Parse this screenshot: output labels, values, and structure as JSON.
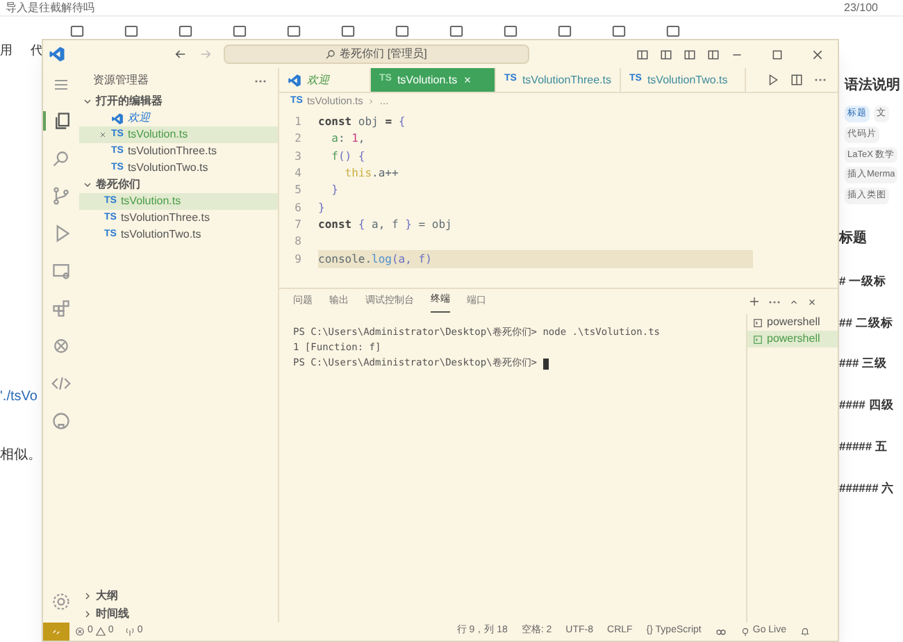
{
  "browser": {
    "top_text": "导入是往截解待吗",
    "counter": "23/100",
    "toolbar_labels": [
      "用",
      "代"
    ],
    "left_fragments": [
      "'./tsVo",
      "相似。"
    ],
    "right_panel": {
      "title": "语法说明",
      "tags": [
        {
          "label": "标题",
          "selected": true
        },
        {
          "label": "文",
          "selected": false
        },
        {
          "label": "代码片",
          "selected": false
        },
        {
          "label": "LaTeX 数学",
          "selected": false
        },
        {
          "label": "插入Merma",
          "selected": false
        },
        {
          "label": "插入类图",
          "selected": false
        }
      ],
      "section": "标题",
      "headings": [
        "# 一级标",
        "## 二级标",
        "### 三级",
        "#### 四级",
        "##### 五",
        "###### 六"
      ]
    }
  },
  "window": {
    "title": "卷死你们 [管理员]",
    "sidebar": {
      "title": "资源管理器",
      "open_editors": {
        "label": "打开的编辑器",
        "expanded": true,
        "items": [
          {
            "label": "欢迎",
            "kind": "welcome",
            "selected": false
          },
          {
            "label": "tsVolution.ts",
            "kind": "ts",
            "icon": "TS",
            "selected": true
          },
          {
            "label": "tsVolutionThree.ts",
            "kind": "ts",
            "icon": "TS",
            "selected": false
          },
          {
            "label": "tsVolutionTwo.ts",
            "kind": "ts",
            "icon": "TS",
            "selected": false
          }
        ]
      },
      "folder": {
        "label": "卷死你们",
        "expanded": true,
        "items": [
          {
            "label": "tsVolution.ts",
            "icon": "TS",
            "selected": true
          },
          {
            "label": "tsVolutionThree.ts",
            "icon": "TS",
            "selected": false
          },
          {
            "label": "tsVolutionTwo.ts",
            "icon": "TS",
            "selected": false
          }
        ]
      },
      "bottom_sections": [
        "大纲",
        "时间线"
      ]
    },
    "tabs": [
      {
        "label": "欢迎",
        "kind": "welcome",
        "selected": false
      },
      {
        "label": "tsVolution.ts",
        "kind": "ts",
        "icon": "TS",
        "selected": true
      },
      {
        "label": "tsVolutionThree.ts",
        "kind": "ts",
        "icon": "TS",
        "selected": false
      },
      {
        "label": "tsVolutionTwo.ts",
        "kind": "ts",
        "icon": "TS",
        "selected": false
      }
    ],
    "breadcrumb": {
      "icon": "TS",
      "parts": [
        "tsVolution.ts",
        "..."
      ]
    },
    "code": [
      {
        "n": "1",
        "selected": false,
        "tokens": [
          {
            "text": "const",
            "kind": "keyword"
          },
          {
            "text": " obj ",
            "kind": "plain"
          },
          {
            "text": "=",
            "kind": "keyword"
          },
          {
            "text": " {",
            "kind": "bracket"
          }
        ]
      },
      {
        "n": "2",
        "selected": false,
        "tokens": [
          {
            "text": "  a",
            "kind": "property"
          },
          {
            "text": ": ",
            "kind": "plain"
          },
          {
            "text": "1",
            "kind": "number"
          },
          {
            "text": ",",
            "kind": "plain"
          }
        ]
      },
      {
        "n": "3",
        "selected": false,
        "tokens": [
          {
            "text": "  f",
            "kind": "property"
          },
          {
            "text": "() {",
            "kind": "bracket"
          }
        ]
      },
      {
        "n": "4",
        "selected": false,
        "tokens": [
          {
            "text": "    this",
            "kind": "this"
          },
          {
            "text": ".a++",
            "kind": "plain"
          }
        ]
      },
      {
        "n": "5",
        "selected": false,
        "tokens": [
          {
            "text": "  }",
            "kind": "bracket"
          }
        ]
      },
      {
        "n": "6",
        "selected": false,
        "tokens": [
          {
            "text": "}",
            "kind": "bracket"
          }
        ]
      },
      {
        "n": "7",
        "selected": false,
        "tokens": [
          {
            "text": "const",
            "kind": "keyword"
          },
          {
            "text": " { ",
            "kind": "bracket"
          },
          {
            "text": "a, f",
            "kind": "plain"
          },
          {
            "text": " } ",
            "kind": "bracket"
          },
          {
            "text": "= obj",
            "kind": "plain"
          }
        ]
      },
      {
        "n": "8",
        "selected": false
      },
      {
        "n": "9",
        "selected": true,
        "tokens": [
          {
            "text": "console.",
            "kind": "plain"
          },
          {
            "text": "log",
            "kind": "function"
          },
          {
            "text": "(a, f)",
            "kind": "bracket"
          }
        ]
      }
    ],
    "panel": {
      "tabs": [
        {
          "label": "问题",
          "selected": false
        },
        {
          "label": "输出",
          "selected": false
        },
        {
          "label": "调试控制台",
          "selected": false
        },
        {
          "label": "终端",
          "selected": true
        },
        {
          "label": "端口",
          "selected": false
        }
      ],
      "terminal": [
        "PS C:\\Users\\Administrator\\Desktop\\卷死你们> node .\\tsVolution.ts",
        "1 [Function: f]",
        "PS C:\\Users\\Administrator\\Desktop\\卷死你们> "
      ],
      "shells": [
        {
          "label": "powershell",
          "selected": false
        },
        {
          "label": "powershell",
          "selected": true
        }
      ]
    },
    "status_bar": {
      "errors": "0",
      "warnings": "0",
      "ports": "0",
      "right": [
        "行 9，列 18",
        "空格: 2",
        "UTF-8",
        "CRLF",
        "{} TypeScript"
      ],
      "go_live": "Go Live"
    }
  }
}
